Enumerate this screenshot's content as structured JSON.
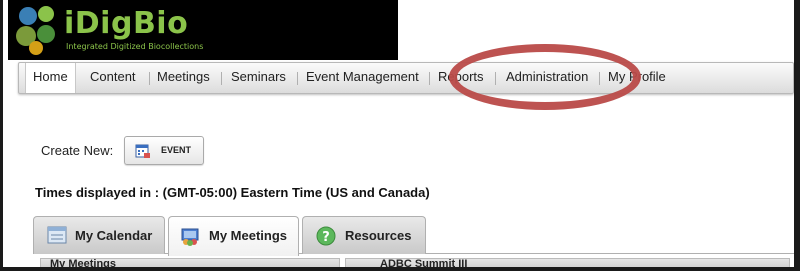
{
  "logo": {
    "name": "iDigBio",
    "tagline": "Integrated Digitized Biocollections"
  },
  "nav": {
    "items": [
      {
        "label": "Home"
      },
      {
        "label": "Content"
      },
      {
        "label": "Meetings"
      },
      {
        "label": "Seminars"
      },
      {
        "label": "Event Management"
      },
      {
        "label": "Reports"
      },
      {
        "label": "Administration"
      },
      {
        "label": "My Profile"
      }
    ]
  },
  "create": {
    "label": "Create New:",
    "event_button": "EVENT"
  },
  "timezone": "Times displayed in : (GMT-05:00) Eastern Time (US and Canada)",
  "tabs": [
    {
      "label": "My Calendar"
    },
    {
      "label": "My Meetings"
    },
    {
      "label": "Resources"
    }
  ],
  "lower": {
    "left_title": "My Meetings",
    "right_title": "ADBC Summit III"
  },
  "colors": {
    "annotation": "#b94a48",
    "brand_green": "#8bc34a"
  }
}
